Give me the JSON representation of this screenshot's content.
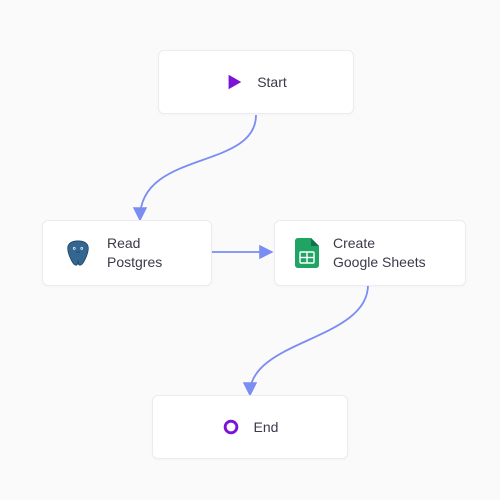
{
  "flow": {
    "nodes": {
      "start": {
        "label": "Start",
        "icon": "play-icon"
      },
      "read_postgres": {
        "label": "Read\nPostgres",
        "icon": "postgres-icon"
      },
      "create_sheets": {
        "label": "Create\nGoogle Sheets",
        "icon": "google-sheets-icon"
      },
      "end": {
        "label": "End",
        "icon": "ring-icon"
      }
    },
    "edges": [
      {
        "from": "start",
        "to": "read_postgres"
      },
      {
        "from": "read_postgres",
        "to": "create_sheets"
      },
      {
        "from": "create_sheets",
        "to": "end"
      }
    ],
    "colors": {
      "accent_purple": "#7b12d4",
      "connector": "#7b8cf2",
      "sheets_green": "#1fa463",
      "postgres_blue": "#336791"
    }
  }
}
